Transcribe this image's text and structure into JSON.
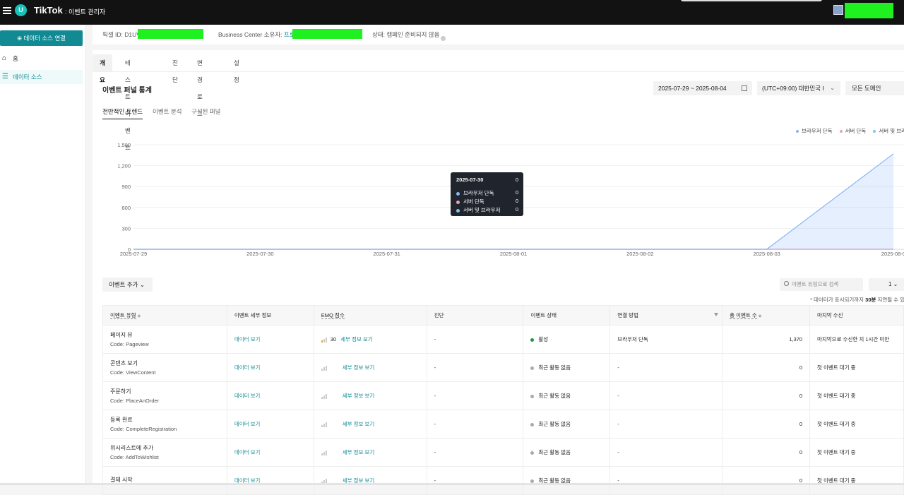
{
  "topbar": {
    "logo_letter": "U",
    "brand": "TikTok",
    "brand_sub": ": 이벤트 관리자"
  },
  "sidebar": {
    "connect_label": "⊕ 데이터 소스 연결",
    "items": [
      {
        "label": "홈",
        "icon": "home-icon"
      },
      {
        "label": "데이터 소스",
        "icon": "list-icon"
      }
    ]
  },
  "infobar": {
    "pixel_label": "픽셀 ID: D1UV",
    "bc_label": "Business Center 소유자: ",
    "bc_value": "프로",
    "status_label": "상태: 캠페인 준비되지 않음"
  },
  "tabs": [
    "개요",
    "테스트 이벤트",
    "진단",
    "변경 로그",
    "설정"
  ],
  "section_title": "이벤트 퍼널 통계",
  "filters": {
    "date_range": "2025-07-29 ~ 2025-08-04",
    "timezone": "(UTC+09:00) 대한민국 I",
    "domain": "모든 도메인"
  },
  "subtabs": [
    "전반적인 트렌드",
    "이벤트 분석",
    "구성된 퍼널"
  ],
  "legend": [
    {
      "name": "브라우저 단독",
      "color": "#8ab4f8"
    },
    {
      "name": "서버 단독",
      "color": "#e6a0c4"
    },
    {
      "name": "서버 및 브라우저",
      "color": "#7ec8f0"
    }
  ],
  "chart_data": {
    "type": "area",
    "x": [
      "2025-07-29",
      "2025-07-30",
      "2025-07-31",
      "2025-08-01",
      "2025-08-02",
      "2025-08-03",
      "2025-08-04"
    ],
    "x_tick_labels": [
      "2025-07-29",
      "2025-07-30",
      "2025-07-31",
      "2025-08-01",
      "2025-08-02",
      "2025-08-03",
      "2025-08-0"
    ],
    "y_ticks": [
      0,
      300,
      600,
      900,
      1200,
      1500
    ],
    "y_tick_labels": [
      "0",
      "300",
      "600",
      "900",
      "1,200",
      "1,500"
    ],
    "ylim": [
      0,
      1500
    ],
    "grid": true,
    "legend_position": "top-right",
    "series": [
      {
        "name": "브라우저 단독",
        "values": [
          0,
          0,
          0,
          0,
          0,
          0,
          1370
        ]
      },
      {
        "name": "서버 단독",
        "values": [
          0,
          0,
          0,
          0,
          0,
          0,
          0
        ]
      },
      {
        "name": "서버 및 브라우저",
        "values": [
          0,
          0,
          0,
          0,
          0,
          0,
          0
        ]
      }
    ]
  },
  "tooltip": {
    "date": "2025-07-30",
    "total": "0",
    "rows": [
      {
        "name": "브라우저 단독",
        "value": "0",
        "color": "#8ab4f8"
      },
      {
        "name": "서버 단독",
        "value": "0",
        "color": "#e6a0c4"
      },
      {
        "name": "서버 및 브라우저",
        "value": "0",
        "color": "#7ec8f0"
      }
    ]
  },
  "table_controls": {
    "add_event": "이벤트 추가 ⌄",
    "search_placeholder": "이벤트 유형으로 검색",
    "page": "1 ⌄",
    "delay_note_pre": "* 데이터가 표시되기까지 ",
    "delay_note_bold": "30분",
    "delay_note_post": " 지연될 수 있습"
  },
  "table": {
    "headers": [
      "이벤트 유형",
      "이벤트 세부 정보",
      "EMQ 점수",
      "진단",
      "이벤트 상태",
      "연결 방법",
      "총 이벤트 수",
      "마지막 수신"
    ],
    "rows": [
      {
        "name": "페이지 뷰",
        "code": "Code: Pageview",
        "details": "데이터 보기",
        "emq_score": "30",
        "emq_link": "세부 정보 보기",
        "diag": "-",
        "status": "활성",
        "status_color": "#1a9a3a",
        "method": "브라우저 단독",
        "total": "1,370",
        "last": "마지막으로 수신한 지 1시간 미만"
      },
      {
        "name": "콘텐츠 보기",
        "code": "Code: ViewContent",
        "details": "데이터 보기",
        "emq_score": "",
        "emq_link": "세부 정보 보기",
        "diag": "-",
        "status": "최근 활동 없음",
        "status_color": "#aaaaaa",
        "method": "-",
        "total": "0",
        "last": "첫 이벤트 대기 중"
      },
      {
        "name": "주문하기",
        "code": "Code: PlaceAnOrder",
        "details": "데이터 보기",
        "emq_score": "",
        "emq_link": "세부 정보 보기",
        "diag": "-",
        "status": "최근 활동 없음",
        "status_color": "#aaaaaa",
        "method": "-",
        "total": "0",
        "last": "첫 이벤트 대기 중"
      },
      {
        "name": "등록 완료",
        "code": "Code: CompleteRegistration",
        "details": "데이터 보기",
        "emq_score": "",
        "emq_link": "세부 정보 보기",
        "diag": "-",
        "status": "최근 활동 없음",
        "status_color": "#aaaaaa",
        "method": "-",
        "total": "0",
        "last": "첫 이벤트 대기 중"
      },
      {
        "name": "위시리스트에 추가",
        "code": "Code: AddToWishlist",
        "details": "데이터 보기",
        "emq_score": "",
        "emq_link": "세부 정보 보기",
        "diag": "-",
        "status": "최근 활동 없음",
        "status_color": "#aaaaaa",
        "method": "-",
        "total": "0",
        "last": "첫 이벤트 대기 중"
      },
      {
        "name": "결제 시작",
        "code": "",
        "details": "데이터 보기",
        "emq_score": "",
        "emq_link": "세부 정보 보기",
        "diag": "-",
        "status": "최근 활동 없음",
        "status_color": "#aaaaaa",
        "method": "-",
        "total": "0",
        "last": "첫 이벤트 대기 중"
      }
    ]
  }
}
